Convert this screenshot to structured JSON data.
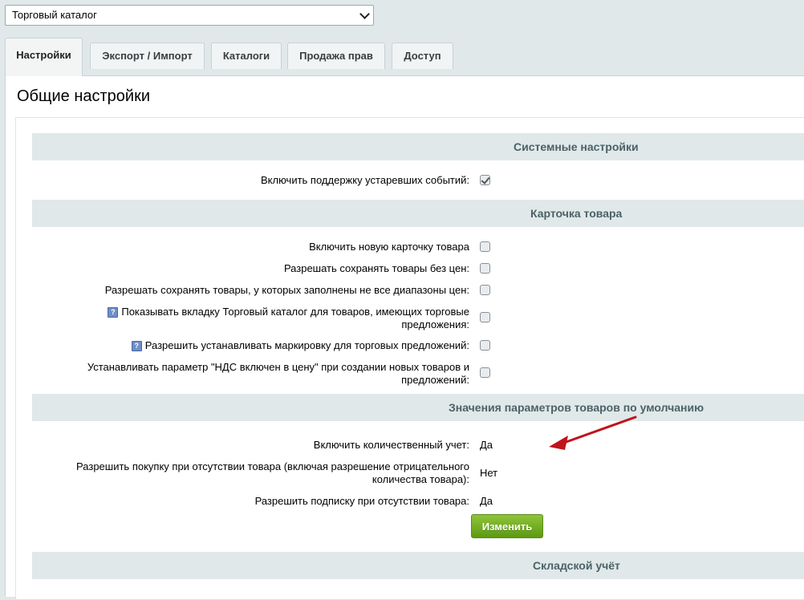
{
  "module_select": {
    "value": "Торговый каталог"
  },
  "tabs": [
    {
      "label": "Настройки"
    },
    {
      "label": "Экспорт / Импорт"
    },
    {
      "label": "Каталоги"
    },
    {
      "label": "Продажа прав"
    },
    {
      "label": "Доступ"
    }
  ],
  "page_title": "Общие настройки",
  "sections": {
    "system": {
      "title": "Системные настройки",
      "rows": [
        {
          "label": "Включить поддержку устаревших событий:",
          "checked": true
        }
      ]
    },
    "product_card": {
      "title": "Карточка товара",
      "rows": [
        {
          "label": "Включить новую карточку товара",
          "checked": false
        },
        {
          "label": "Разрешать сохранять товары без цен:",
          "checked": false
        },
        {
          "label": "Разрешать сохранять товары, у которых заполнены не все диапазоны цен:",
          "checked": false
        },
        {
          "label_line1": "Показывать вкладку Торговый каталог для товаров, имеющих торговые",
          "label_line2": "предложения:",
          "hint": "?",
          "checked": false
        },
        {
          "label": "Разрешить устанавливать маркировку для торговых предложений:",
          "hint": "?",
          "checked": false
        },
        {
          "label_line1": "Устанавливать параметр \"НДС включен в цену\" при создании новых товаров и",
          "label_line2": "предложений:",
          "checked": false
        }
      ]
    },
    "defaults": {
      "title": "Значения параметров товаров по умолчанию",
      "rows": [
        {
          "label": "Включить количественный учет:",
          "value": "Да"
        },
        {
          "label_line1": "Разрешить покупку при отсутствии товара (включая разрешение отрицательного",
          "label_line2": "количества товара):",
          "value": "Нет"
        },
        {
          "label": "Разрешить подписку при отсутствии товара:",
          "value": "Да"
        }
      ],
      "button_label": "Изменить"
    },
    "warehouse": {
      "title": "Складской учёт"
    }
  },
  "colors": {
    "button_green": "#6aaa1e",
    "arrow_red": "#c0141c",
    "section_bg": "#e0e8ea"
  }
}
